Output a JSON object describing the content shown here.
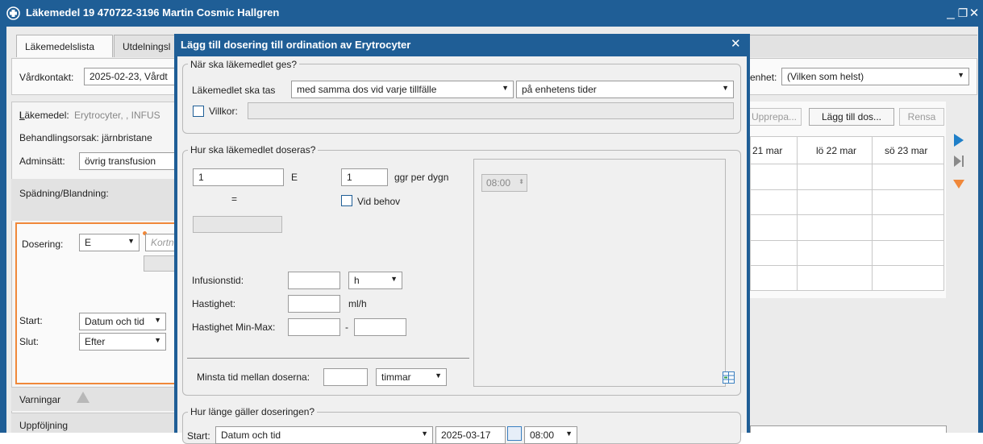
{
  "window": {
    "title": "Läkemedel 19 470722-3196 Martin Cosmic Hallgren",
    "minimize": "_",
    "restore": "❐",
    "close": "✕"
  },
  "tabs": [
    {
      "label": "Läkemedelslista",
      "active": true
    },
    {
      "label": "Utdelningsl"
    }
  ],
  "background": {
    "vardkontakt_label": "Vårdkontakt:",
    "vardkontakt_value": "2025-02-23, Vårdt",
    "enhet_label": "enhet:",
    "enhet_value": "(Vilken som helst)",
    "lakemedel_label": "Läkemedel:",
    "lakemedel_value": "Erytrocyter, , INFUS",
    "behandlingsorsak": "Behandlingsorsak: järnbristane",
    "adminsatt_label": "Adminsätt:",
    "adminsatt_value": "övrig transfusion",
    "spadning_label": "Spädning/Blandning:",
    "dosering_label": "Dosering:",
    "dosering_unit": "E",
    "dosering_placeholder": "Kortn",
    "start_label": "Start:",
    "start_value": "Datum och tid",
    "slut_label": "Slut:",
    "slut_value": "Efter",
    "varningar": "Varningar",
    "uppfoljning": "Uppföljning",
    "upprepa": "Upprepa...",
    "lagg_till_dos": "Lägg till dos...",
    "rensa": "Rensa",
    "days": [
      "21 mar",
      "lö 22 mar",
      "sö 23 mar"
    ]
  },
  "dialog": {
    "title": "Lägg till dosering till ordination av Erytrocyter",
    "close": "✕",
    "when": {
      "title": "När ska läkemedlet ges?",
      "label": "Läkemedlet ska tas",
      "mode": "med samma dos vid varje tillfälle",
      "times": "på enhetens tider",
      "villkor": "Villkor:"
    },
    "how": {
      "title": "Hur ska läkemedlet doseras?",
      "dose": "1",
      "dose_unit": "E",
      "equals": "=",
      "freq": "1",
      "freq_label": "ggr per dygn",
      "vid_behov": "Vid behov",
      "time": "08:00",
      "infusionstid_label": "Infusionstid:",
      "infusionstid_unit": "h",
      "hastighet_label": "Hastighet:",
      "hastighet_unit": "ml/h",
      "minmax_label": "Hastighet Min-Max:",
      "minmax_sep": "-",
      "minsta_label": "Minsta tid mellan doserna:",
      "minsta_unit": "timmar"
    },
    "duration": {
      "title": "Hur länge gäller doseringen?",
      "start_label": "Start:",
      "start_value": "Datum och tid",
      "date": "2025-03-17",
      "time": "08:00"
    }
  },
  "colors": {
    "titlebar": "#1f5e96",
    "accent_orange": "#f0883a",
    "play_blue": "#1f7fc8"
  }
}
